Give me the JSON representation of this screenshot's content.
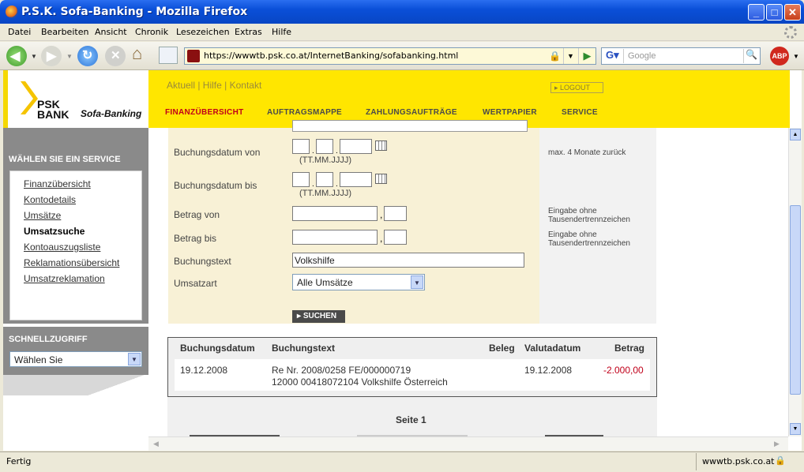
{
  "window": {
    "title": "P.S.K. Sofa-Banking - Mozilla Firefox"
  },
  "menu": [
    "Datei",
    "Bearbeiten",
    "Ansicht",
    "Chronik",
    "Lesezeichen",
    "Extras",
    "Hilfe"
  ],
  "toolbar": {
    "url": "https://wwwtb.psk.co.at/InternetBanking/sofabanking.html",
    "search_placeholder": "Google",
    "abp_label": "ABP"
  },
  "site": {
    "logo_line1": "PSK",
    "logo_line2": "BANK",
    "logo_product": "Sofa-Banking",
    "top_links": "Aktuell | Hilfe | Kontakt",
    "logout": "LOGOUT",
    "nav": [
      "FINANZÜBERSICHT",
      "AUFTRAGSMAPPE",
      "ZAHLUNGSAUFTRÄGE",
      "WERTPAPIER",
      "SERVICE"
    ]
  },
  "sidebar": {
    "header": "WÄHLEN SIE EIN SERVICE",
    "items": [
      "Finanzübersicht",
      "Kontodetails",
      "Umsätze",
      "Umsatzsuche",
      "Kontoauszugsliste",
      "Reklamationsübersicht",
      "Umsatzreklamation"
    ],
    "active_index": 3,
    "quick_header": "SCHNELLZUGRIFF",
    "quick_value": "Wählen Sie"
  },
  "form": {
    "date_from_label": "Buchungsdatum von",
    "date_to_label": "Buchungsdatum bis",
    "date_hint": "(TT.MM.JJJJ)",
    "date_note": "max. 4 Monate zurück",
    "amount_from_label": "Betrag von",
    "amount_to_label": "Betrag bis",
    "amount_note_line1": "Eingabe ohne",
    "amount_note_line2": "Tausendertrennzeichen",
    "text_label": "Buchungstext",
    "text_value": "Volkshilfe",
    "type_label": "Umsatzart",
    "type_value": "Alle Umsätze",
    "search_button": "SUCHEN"
  },
  "results": {
    "headers": [
      "Buchungsdatum",
      "Buchungstext",
      "Beleg",
      "Valutadatum",
      "Betrag"
    ],
    "rows": [
      {
        "date": "19.12.2008",
        "text_line1": "Re Nr. 2008/0258 FE/000000719",
        "text_line2": "12000 00418072104 Volkshilfe Österreich",
        "beleg": "",
        "valuta": "19.12.2008",
        "amount": "-2.000,00"
      }
    ],
    "page_label": "Seite 1"
  },
  "status": {
    "left": "Fertig",
    "right": "wwwtb.psk.co.at"
  },
  "colors": {
    "brand_yellow": "#ffe600",
    "active_red": "#c0001a",
    "negative_amount": "#c0001a"
  }
}
